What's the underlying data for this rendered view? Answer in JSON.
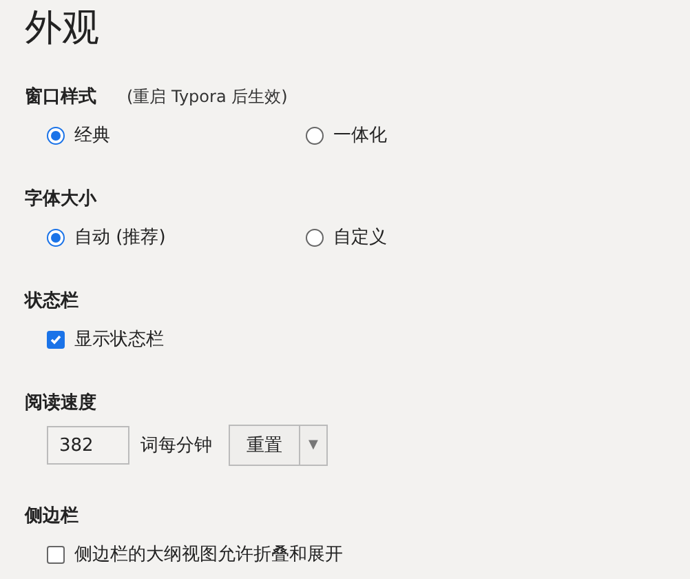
{
  "title": "外观",
  "sections": [
    {
      "kind": "radio",
      "heading": "窗口样式",
      "note": "(重启 Typora 后生效)",
      "options": [
        {
          "label": "经典",
          "selected": true
        },
        {
          "label": "一体化",
          "selected": false
        }
      ]
    },
    {
      "kind": "radio",
      "heading": "字体大小",
      "options": [
        {
          "label": "自动 (推荐)",
          "selected": true
        },
        {
          "label": "自定义",
          "selected": false
        }
      ]
    },
    {
      "kind": "checkbox",
      "heading": "状态栏",
      "options": [
        {
          "label": "显示状态栏",
          "checked": true
        }
      ]
    },
    {
      "kind": "number",
      "heading": "阅读速度",
      "value": "382",
      "unit": "词每分钟",
      "button": "重置",
      "caret": "▼"
    },
    {
      "kind": "checkbox",
      "heading": "侧边栏",
      "options": [
        {
          "label": "侧边栏的大纲视图允许折叠和展开",
          "checked": false
        }
      ]
    }
  ]
}
